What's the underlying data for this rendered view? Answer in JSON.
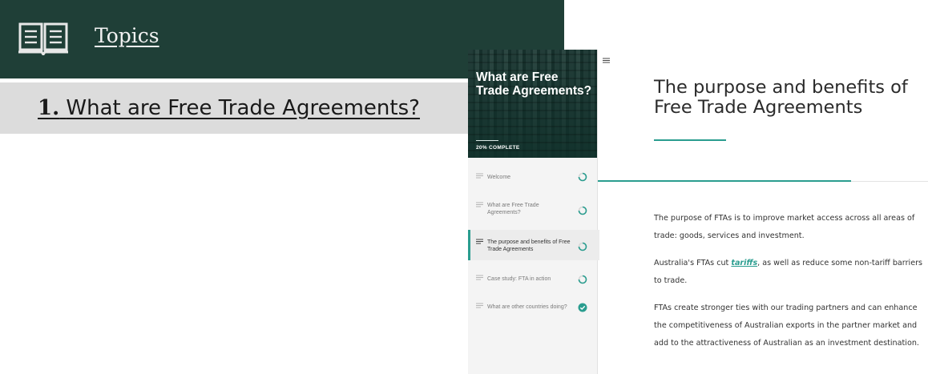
{
  "topics_panel": {
    "header_label": "Topics",
    "topic_number": "1.",
    "topic_title": "What are Free Trade Agreements?"
  },
  "course": {
    "hero_title": "What are Free Trade Agreements?",
    "progress_text": "20% COMPLETE",
    "progress_percent": 20,
    "nav_items": [
      {
        "label": "Welcome",
        "status": "in-progress"
      },
      {
        "label": "What are Free Trade Agreements?",
        "status": "in-progress"
      },
      {
        "label": "The purpose and benefits of Free Trade Agreements",
        "status": "in-progress",
        "active": true
      },
      {
        "label": "Case study: FTA in action",
        "status": "in-progress"
      },
      {
        "label": "What are other countries doing?",
        "status": "complete"
      }
    ],
    "lesson_title": "The purpose and benefits of Free Trade Agreements",
    "paragraphs": {
      "p1": "The purpose of FTAs is to improve market access across all areas of trade: goods, services and investment.",
      "p2_before": "Australia's FTAs cut ",
      "p2_link": "tariffs",
      "p2_after": ", as well as reduce some non-tariff barriers to trade.",
      "p3": "FTAs create stronger ties with our trading partners and can enhance the competitiveness of Australian exports in the partner market and add to the attractiveness of Australian as an investment destination."
    }
  },
  "colors": {
    "header_bg": "#1f3f37",
    "accent": "#2a9d8f",
    "topic_row_bg": "#dcdcdc"
  },
  "icons": {
    "header": "book-icon",
    "menu": "hamburger-menu-icon",
    "nav_item": "lines-icon",
    "status_in_progress": "progress-ring-icon",
    "status_complete": "check-circle-icon"
  }
}
